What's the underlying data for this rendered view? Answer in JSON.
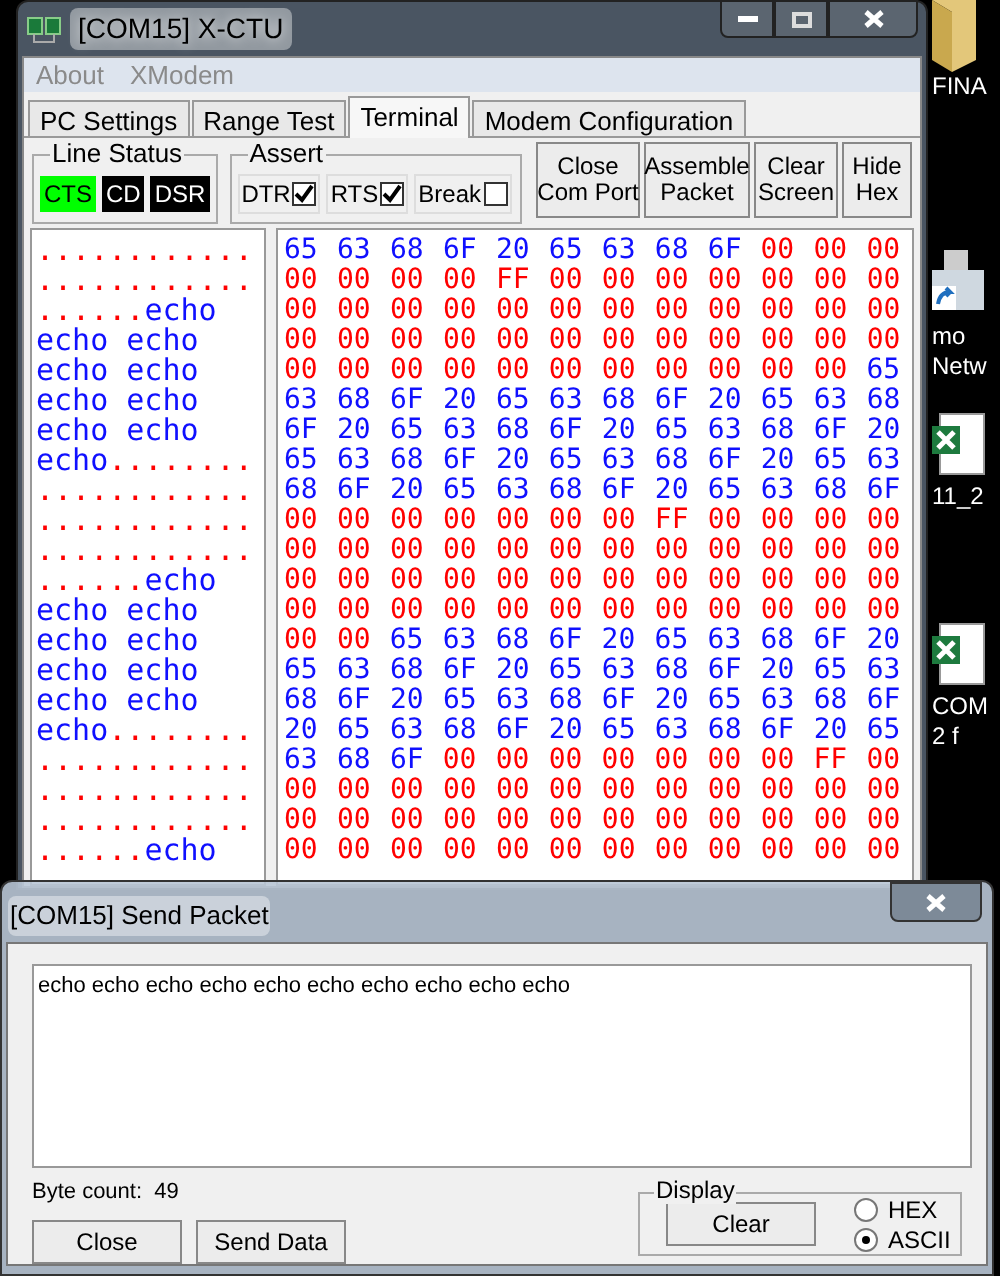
{
  "window": {
    "title": "[COM15] X-CTU"
  },
  "menu": [
    {
      "label": "About",
      "disabled": true
    },
    {
      "label": "XModem",
      "disabled": true
    }
  ],
  "tabs": [
    {
      "label": "PC Settings",
      "selected": false
    },
    {
      "label": "Range Test",
      "selected": false
    },
    {
      "label": "Terminal",
      "selected": true
    },
    {
      "label": "Modem Configuration",
      "selected": false
    }
  ],
  "line_status": {
    "title": "Line Status",
    "indicators": [
      {
        "label": "CTS",
        "on": true
      },
      {
        "label": "CD",
        "on": false
      },
      {
        "label": "DSR",
        "on": false
      }
    ]
  },
  "assert": {
    "title": "Assert",
    "options": [
      {
        "label": "DTR",
        "checked": true
      },
      {
        "label": "RTS",
        "checked": true
      },
      {
        "label": "Break",
        "checked": false
      }
    ]
  },
  "buttons": [
    {
      "lines": [
        "Close",
        "Com Port"
      ]
    },
    {
      "lines": [
        "Assemble",
        "Packet"
      ]
    },
    {
      "lines": [
        "Clear",
        "Screen"
      ]
    },
    {
      "lines": [
        "Hide",
        "Hex"
      ]
    }
  ],
  "terminal": {
    "rows": [
      {
        "ascii": [
          {
            "kind": "received",
            "text": "............"
          }
        ],
        "hex": [
          {
            "kind": "sent",
            "text": "65 63 68 6F 20 65 63 68 6F"
          },
          {
            "kind": "received",
            "text": "00 00 00"
          }
        ]
      },
      {
        "ascii": [
          {
            "kind": "received",
            "text": "............"
          }
        ],
        "hex": [
          {
            "kind": "received",
            "text": "00 00 00 00 FF 00 00 00 00 00 00 00"
          }
        ]
      },
      {
        "ascii": [
          {
            "kind": "received",
            "text": "......"
          },
          {
            "kind": "sent",
            "text": "echo"
          }
        ],
        "hex": [
          {
            "kind": "received",
            "text": "00 00 00 00 00 00 00 00 00 00 00 00"
          }
        ]
      },
      {
        "ascii": [
          {
            "kind": "sent",
            "text": "echo echo"
          }
        ],
        "hex": [
          {
            "kind": "received",
            "text": "00 00 00 00 00 00 00 00 00 00 00 00"
          }
        ]
      },
      {
        "ascii": [
          {
            "kind": "sent",
            "text": "echo echo"
          }
        ],
        "hex": [
          {
            "kind": "received",
            "text": "00 00 00 00 00 00 00 00 00 00 00"
          },
          {
            "kind": "sent",
            "text": "65"
          }
        ]
      },
      {
        "ascii": [
          {
            "kind": "sent",
            "text": "echo echo"
          }
        ],
        "hex": [
          {
            "kind": "sent",
            "text": "63 68 6F 20 65 63 68 6F 20 65 63 68"
          }
        ]
      },
      {
        "ascii": [
          {
            "kind": "sent",
            "text": "echo echo"
          }
        ],
        "hex": [
          {
            "kind": "sent",
            "text": "6F 20 65 63 68 6F 20 65 63 68 6F 20"
          }
        ]
      },
      {
        "ascii": [
          {
            "kind": "sent",
            "text": "echo"
          },
          {
            "kind": "received",
            "text": "........"
          }
        ],
        "hex": [
          {
            "kind": "sent",
            "text": "65 63 68 6F 20 65 63 68 6F 20 65 63"
          }
        ]
      },
      {
        "ascii": [
          {
            "kind": "received",
            "text": "............"
          }
        ],
        "hex": [
          {
            "kind": "sent",
            "text": "68 6F 20 65 63 68 6F 20 65 63 68 6F"
          }
        ]
      },
      {
        "ascii": [
          {
            "kind": "received",
            "text": "............"
          }
        ],
        "hex": [
          {
            "kind": "received",
            "text": "00 00 00 00 00 00 00 FF 00 00 00 00"
          }
        ]
      },
      {
        "ascii": [
          {
            "kind": "received",
            "text": "............"
          }
        ],
        "hex": [
          {
            "kind": "received",
            "text": "00 00 00 00 00 00 00 00 00 00 00 00"
          }
        ]
      },
      {
        "ascii": [
          {
            "kind": "received",
            "text": "......"
          },
          {
            "kind": "sent",
            "text": "echo"
          }
        ],
        "hex": [
          {
            "kind": "received",
            "text": "00 00 00 00 00 00 00 00 00 00 00 00"
          }
        ]
      },
      {
        "ascii": [
          {
            "kind": "sent",
            "text": "echo echo"
          }
        ],
        "hex": [
          {
            "kind": "received",
            "text": "00 00 00 00 00 00 00 00 00 00 00 00"
          }
        ]
      },
      {
        "ascii": [
          {
            "kind": "sent",
            "text": "echo echo"
          }
        ],
        "hex": [
          {
            "kind": "received",
            "text": "00 00"
          },
          {
            "kind": "sent",
            "text": "65 63 68 6F 20 65 63 68 6F 20"
          }
        ]
      },
      {
        "ascii": [
          {
            "kind": "sent",
            "text": "echo echo"
          }
        ],
        "hex": [
          {
            "kind": "sent",
            "text": "65 63 68 6F 20 65 63 68 6F 20 65 63"
          }
        ]
      },
      {
        "ascii": [
          {
            "kind": "sent",
            "text": "echo echo"
          }
        ],
        "hex": [
          {
            "kind": "sent",
            "text": "68 6F 20 65 63 68 6F 20 65 63 68 6F"
          }
        ]
      },
      {
        "ascii": [
          {
            "kind": "sent",
            "text": "echo"
          },
          {
            "kind": "received",
            "text": "........"
          }
        ],
        "hex": [
          {
            "kind": "sent",
            "text": "20 65 63 68 6F 20 65 63 68 6F 20 65"
          }
        ]
      },
      {
        "ascii": [
          {
            "kind": "received",
            "text": "............"
          }
        ],
        "hex": [
          {
            "kind": "sent",
            "text": "63 68 6F"
          },
          {
            "kind": "received",
            "text": "00 00 00 00 00 00 00 FF 00"
          }
        ]
      },
      {
        "ascii": [
          {
            "kind": "received",
            "text": "............"
          }
        ],
        "hex": [
          {
            "kind": "received",
            "text": "00 00 00 00 00 00 00 00 00 00 00 00"
          }
        ]
      },
      {
        "ascii": [
          {
            "kind": "received",
            "text": "............"
          }
        ],
        "hex": [
          {
            "kind": "received",
            "text": "00 00 00 00 00 00 00 00 00 00 00 00"
          }
        ]
      },
      {
        "ascii": [
          {
            "kind": "received",
            "text": "......"
          },
          {
            "kind": "sent",
            "text": "echo"
          }
        ],
        "hex": [
          {
            "kind": "received",
            "text": "00 00 00 00 00 00 00 00 00 00 00 00"
          }
        ]
      }
    ]
  },
  "desktop_icons": [
    {
      "kind": "folder",
      "lines": [
        "FINA"
      ]
    },
    {
      "kind": "shortcut",
      "lines": [
        "mo",
        "Netw"
      ]
    },
    {
      "kind": "spreadsheet",
      "lines": [
        "11_2"
      ]
    },
    {
      "kind": "spreadsheet",
      "lines": [
        "COM",
        "2 f"
      ]
    }
  ],
  "send_packet": {
    "title": "[COM15] Send Packet",
    "text": "echo echo echo echo echo echo echo echo echo echo",
    "byte_count": "Byte count:  49",
    "buttons": [
      "Close",
      "Send Data"
    ],
    "display": {
      "title": "Display",
      "button": "Clear",
      "options": [
        {
          "label": "HEX",
          "selected": false
        },
        {
          "label": "ASCII",
          "selected": true
        }
      ]
    }
  }
}
